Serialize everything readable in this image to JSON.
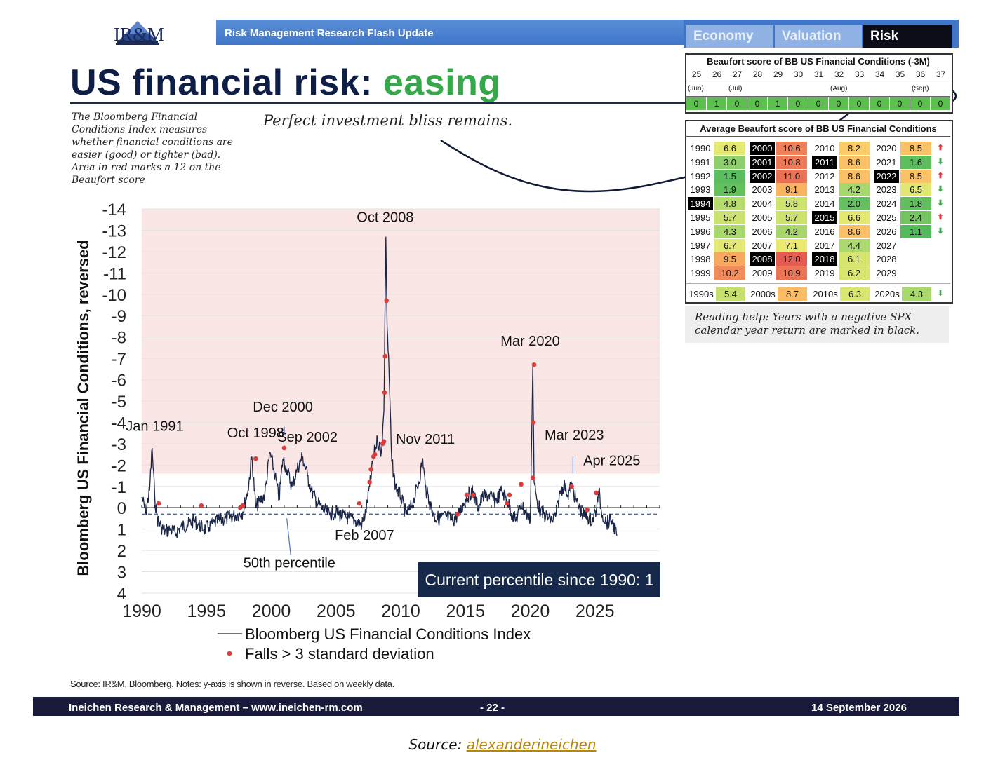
{
  "header": {
    "logo_text": "IR&M",
    "flash_title": "Risk Management Research Flash Update",
    "tabs": [
      {
        "label": "Economy",
        "active": false
      },
      {
        "label": "Valuation",
        "active": false
      },
      {
        "label": "Risk",
        "active": true
      }
    ]
  },
  "title": {
    "main": "US financial risk: ",
    "highlight": "easing"
  },
  "description": "The Bloomberg Financial Conditions Index measures whether financial conditions are easier (good) or tighter (bad). Area in red marks a 12 on the Beaufort score",
  "subtitle": "Perfect investment bliss remains.",
  "weekly_table": {
    "title": "Beaufort score of BB US Financial Conditions (-3M)",
    "weeks": [
      "25",
      "26",
      "27",
      "28",
      "29",
      "30",
      "31",
      "32",
      "33",
      "34",
      "35",
      "36",
      "37"
    ],
    "months": [
      {
        "label": "(Jun)",
        "col": 0
      },
      {
        "label": "(Jul)",
        "col": 2
      },
      {
        "label": "(Aug)",
        "col": 7
      },
      {
        "label": "(Sep)",
        "col": 11
      }
    ],
    "scores": [
      "0",
      "1",
      "0",
      "0",
      "1",
      "0",
      "0",
      "0",
      "0",
      "0",
      "0",
      "0",
      "0"
    ]
  },
  "annual_table": {
    "title": "Average Beaufort score of BB US Financial Conditions",
    "columns": [
      [
        {
          "year": "1990",
          "score": "6.6",
          "neg": false,
          "color": "#e3e872"
        },
        {
          "year": "1991",
          "score": "3.0",
          "neg": false,
          "color": "#8fce6c"
        },
        {
          "year": "1992",
          "score": "1.5",
          "neg": false,
          "color": "#5bbd5f"
        },
        {
          "year": "1993",
          "score": "1.9",
          "neg": false,
          "color": "#63c05f"
        },
        {
          "year": "1994",
          "score": "4.8",
          "neg": true,
          "color": "#b6dc6e"
        },
        {
          "year": "1995",
          "score": "5.7",
          "neg": false,
          "color": "#cbe26f"
        },
        {
          "year": "1996",
          "score": "4.3",
          "neg": false,
          "color": "#a9d86c"
        },
        {
          "year": "1997",
          "score": "6.7",
          "neg": false,
          "color": "#e3e872"
        },
        {
          "year": "1998",
          "score": "9.5",
          "neg": false,
          "color": "#f7a860"
        },
        {
          "year": "1999",
          "score": "10.2",
          "neg": false,
          "color": "#f08c5a"
        }
      ],
      [
        {
          "year": "2000",
          "score": "10.6",
          "neg": true,
          "color": "#ee8159"
        },
        {
          "year": "2001",
          "score": "10.8",
          "neg": true,
          "color": "#ec7a58"
        },
        {
          "year": "2002",
          "score": "11.0",
          "neg": true,
          "color": "#ea7056"
        },
        {
          "year": "2003",
          "score": "9.1",
          "neg": false,
          "color": "#f9b463"
        },
        {
          "year": "2004",
          "score": "5.8",
          "neg": false,
          "color": "#cde36f"
        },
        {
          "year": "2005",
          "score": "5.7",
          "neg": false,
          "color": "#cbe26f"
        },
        {
          "year": "2006",
          "score": "4.2",
          "neg": false,
          "color": "#a7d76c"
        },
        {
          "year": "2007",
          "score": "7.1",
          "neg": false,
          "color": "#ebe873"
        },
        {
          "year": "2008",
          "score": "12.0",
          "neg": true,
          "color": "#e45b52"
        },
        {
          "year": "2009",
          "score": "10.9",
          "neg": false,
          "color": "#eb7457"
        }
      ],
      [
        {
          "year": "2010",
          "score": "8.2",
          "neg": false,
          "color": "#fbcc6a"
        },
        {
          "year": "2011",
          "score": "8.6",
          "neg": true,
          "color": "#fac067"
        },
        {
          "year": "2012",
          "score": "8.6",
          "neg": false,
          "color": "#fac067"
        },
        {
          "year": "2013",
          "score": "4.2",
          "neg": false,
          "color": "#a7d76c"
        },
        {
          "year": "2014",
          "score": "2.0",
          "neg": false,
          "color": "#65c15f"
        },
        {
          "year": "2015",
          "score": "6.6",
          "neg": true,
          "color": "#e3e872"
        },
        {
          "year": "2016",
          "score": "8.6",
          "neg": false,
          "color": "#fac067"
        },
        {
          "year": "2017",
          "score": "4.4",
          "neg": false,
          "color": "#acd96d"
        },
        {
          "year": "2018",
          "score": "6.1",
          "neg": true,
          "color": "#d6e570"
        },
        {
          "year": "2019",
          "score": "6.2",
          "neg": false,
          "color": "#d8e670"
        }
      ],
      [
        {
          "year": "2020",
          "score": "8.5",
          "neg": false,
          "color": "#fac267",
          "arrow": "up"
        },
        {
          "year": "2021",
          "score": "1.6",
          "neg": false,
          "color": "#5dbe5f",
          "arrow": "down"
        },
        {
          "year": "2022",
          "score": "8.5",
          "neg": true,
          "color": "#fac267",
          "arrow": "up"
        },
        {
          "year": "2023",
          "score": "6.5",
          "neg": false,
          "color": "#e0e772",
          "arrow": "down"
        },
        {
          "year": "2024",
          "score": "1.8",
          "neg": false,
          "color": "#61bf5f",
          "arrow": "down"
        },
        {
          "year": "2025",
          "score": "2.4",
          "neg": false,
          "color": "#74c562",
          "arrow": "up"
        },
        {
          "year": "2026",
          "score": "1.1",
          "neg": false,
          "color": "#52b95d",
          "arrow": "down"
        },
        {
          "year": "2027",
          "score": "",
          "neg": false,
          "color": "#ffffff"
        },
        {
          "year": "2028",
          "score": "",
          "neg": false,
          "color": "#ffffff"
        },
        {
          "year": "2029",
          "score": "",
          "neg": false,
          "color": "#ffffff"
        }
      ]
    ],
    "decades": [
      {
        "year": "1990s",
        "score": "5.4",
        "color": "#c6e06e"
      },
      {
        "year": "2000s",
        "score": "8.7",
        "color": "#fabd66"
      },
      {
        "year": "2010s",
        "score": "6.3",
        "color": "#dae670"
      },
      {
        "year": "2020s",
        "score": "4.3",
        "color": "#a9d86c",
        "arrow": "down"
      }
    ]
  },
  "reading_help": "Reading help: Years with a negative SPX calendar year return are marked in black.",
  "current_percentile": "Current percentile since 1990: 1",
  "source_note": "Source: IR&M, Bloomberg. Notes: y-axis is shown in reverse. Based on weekly data.",
  "footer": {
    "left": "Ineichen Research & Management – www.ineichen-rm.com",
    "page": "- 22 -",
    "date": "14 September 2026"
  },
  "caption": {
    "prefix": "Source: ",
    "link": "alexanderineichen"
  },
  "chart_data": {
    "type": "line",
    "ylabel": "Bloomberg US Financial Conditions, reversed",
    "y_reversed": true,
    "ylim": [
      4,
      -14
    ],
    "yticks": [
      "-14",
      "-13",
      "-12",
      "-11",
      "-10",
      "-9",
      "-8",
      "-7",
      "-6",
      "-5",
      "-4",
      "-3",
      "-2",
      "-1",
      "0",
      "1",
      "2",
      "3",
      "4"
    ],
    "xlim": [
      1990,
      2030
    ],
    "xticks": [
      "1990",
      "1995",
      "2000",
      "2005",
      "2010",
      "2015",
      "2020",
      "2025"
    ],
    "red_zone": [
      -14,
      -1.6
    ],
    "percentile_50": 0.3,
    "legend": [
      "Bloomberg US Financial Conditions Index",
      "Falls > 3 standard deviation"
    ],
    "colors": {
      "line": "#1a2548",
      "dots": "#e03b3b",
      "zone": "#fbe6e6",
      "median": "#3b6fc4"
    },
    "series": [
      {
        "x": [
          1990.0,
          1990.3,
          1990.6,
          1990.8,
          1991.0,
          1991.2,
          1991.5,
          1991.8,
          1992.2,
          1992.6,
          1993.0,
          1993.5,
          1994.0,
          1994.4,
          1994.8,
          1995.2,
          1995.6,
          1996.0,
          1996.5,
          1997.0,
          1997.4,
          1997.8,
          1998.2,
          1998.5,
          1998.8,
          1999.1,
          1999.5,
          1999.9,
          2000.3,
          2000.6,
          2000.9,
          2001.2,
          2001.6,
          2002.0,
          2002.4,
          2002.8,
          2003.1,
          2003.5,
          2004.0,
          2004.5,
          2005.0,
          2005.5,
          2006.0,
          2006.5,
          2007.0,
          2007.3,
          2007.6,
          2007.9,
          2008.2,
          2008.5,
          2008.7,
          2008.85,
          2008.95,
          2009.1,
          2009.3,
          2009.6,
          2010.0,
          2010.4,
          2010.7,
          2011.0,
          2011.4,
          2011.7,
          2011.9,
          2012.2,
          2012.6,
          2013.0,
          2013.5,
          2014.0,
          2014.5,
          2015.0,
          2015.5,
          2016.0,
          2016.3,
          2016.8,
          2017.3,
          2017.8,
          2018.2,
          2018.6,
          2018.9,
          2019.3,
          2019.8,
          2020.0,
          2020.2,
          2020.3,
          2020.5,
          2020.8,
          2021.2,
          2021.7,
          2022.0,
          2022.3,
          2022.6,
          2022.9,
          2023.2,
          2023.5,
          2024.0,
          2024.4,
          2024.8,
          2025.1,
          2025.3,
          2025.5,
          2025.9,
          2026.3,
          2026.7
        ],
        "y": [
          -0.5,
          0.2,
          -0.8,
          -2.8,
          -0.5,
          0.5,
          0.9,
          1.1,
          1.0,
          1.2,
          0.9,
          0.8,
          0.6,
          0.8,
          1.0,
          0.9,
          0.7,
          0.6,
          0.5,
          0.4,
          0.3,
          0.2,
          -0.8,
          -2.4,
          0.0,
          -0.3,
          -0.6,
          -2.6,
          -1.5,
          -0.4,
          -2.3,
          -1.8,
          -1.0,
          -1.8,
          -2.4,
          -1.5,
          -0.8,
          -0.3,
          0.1,
          0.3,
          0.2,
          0.4,
          0.5,
          0.6,
          0.8,
          0.2,
          -1.0,
          -2.4,
          -3.2,
          -2.6,
          -4.5,
          -12.7,
          -8.5,
          -6.3,
          -2.2,
          -1.0,
          -0.5,
          0.3,
          0.1,
          -0.4,
          -1.2,
          -2.3,
          -1.0,
          -0.3,
          0.4,
          0.5,
          0.4,
          0.6,
          0.3,
          -0.4,
          -0.8,
          0.0,
          -0.5,
          -0.6,
          -0.3,
          -0.8,
          -0.4,
          0.3,
          0.6,
          -0.2,
          0.4,
          0.6,
          -6.7,
          -1.2,
          -0.4,
          0.2,
          0.4,
          0.6,
          0.3,
          -0.7,
          -1.1,
          -0.6,
          -1.1,
          -0.4,
          0.3,
          0.4,
          0.6,
          0.1,
          -0.8,
          0.2,
          0.7,
          0.6,
          1.3
        ]
      },
      {
        "x": [
          1991.3,
          1994.6,
          1997.6,
          1997.8,
          1998.8,
          2001.0,
          2006.8,
          2007.6,
          2007.7,
          2007.9,
          2008.0,
          2008.6,
          2008.7,
          2008.75,
          2008.8,
          2008.9,
          2014.4,
          2015.1,
          2015.6,
          2018.2,
          2018.4,
          2019.3,
          2020.2,
          2020.25,
          2020.3,
          2023.2,
          2024.4,
          2025.1
        ],
        "y": [
          -0.2,
          -0.1,
          0.0,
          -0.1,
          -2.3,
          -2.8,
          -0.2,
          -1.2,
          -1.8,
          -2.4,
          -2.5,
          -3.0,
          -3.1,
          -5.4,
          -7.1,
          -9.7,
          0.3,
          -0.6,
          -0.6,
          -0.2,
          -0.6,
          -1.1,
          -1.4,
          -4.0,
          -6.7,
          -1.0,
          0.1,
          -0.7
        ]
      }
    ],
    "annotations": [
      {
        "text": "Jan 1991",
        "x": 1991.0,
        "y": -3.6
      },
      {
        "text": "Oct 1998",
        "x": 1998.8,
        "y": -3.3
      },
      {
        "text": "Dec 2000",
        "x": 2000.9,
        "y": -4.5
      },
      {
        "text": "Sep 2002",
        "x": 2002.8,
        "y": -3.1
      },
      {
        "text": "Oct 2008",
        "x": 2008.8,
        "y": -13.4
      },
      {
        "text": "Feb 2007",
        "x": 2007.2,
        "y": 1.5
      },
      {
        "text": "Nov 2011",
        "x": 2011.9,
        "y": -3.0
      },
      {
        "text": "Mar 2020",
        "x": 2020.0,
        "y": -7.6
      },
      {
        "text": "Mar 2023",
        "x": 2023.4,
        "y": -3.2
      },
      {
        "text": "Apr 2025",
        "x": 2026.3,
        "y": -2.0
      },
      {
        "text": "50th percentile",
        "x": 2001.4,
        "y": 2.8
      }
    ]
  }
}
